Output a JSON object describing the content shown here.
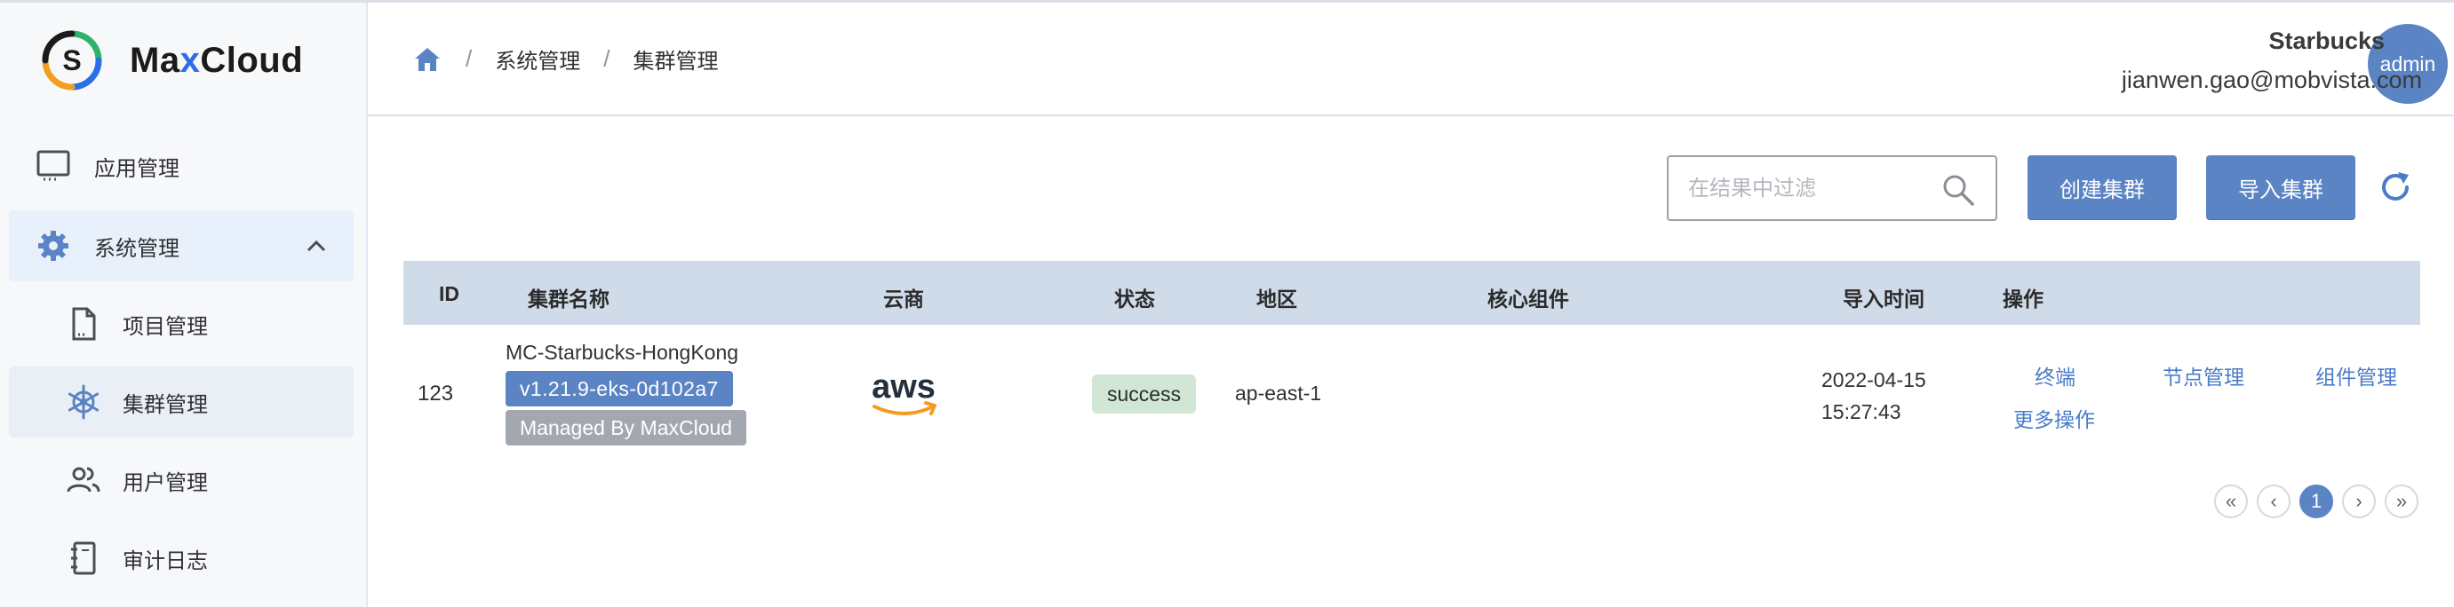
{
  "app": {
    "brand_prefix": "Ma",
    "brand_x": "x",
    "brand_suffix": "Cloud",
    "logo_letter": "S"
  },
  "sidebar": {
    "items": [
      {
        "label": "应用管理",
        "icon": "monitor-icon"
      },
      {
        "label": "系统管理",
        "icon": "gear-icon",
        "expanded": true
      },
      {
        "label": "项目管理",
        "icon": "document-icon"
      },
      {
        "label": "集群管理",
        "icon": "helm-icon",
        "active": true
      },
      {
        "label": "用户管理",
        "icon": "users-icon"
      },
      {
        "label": "审计日志",
        "icon": "notebook-icon"
      }
    ]
  },
  "breadcrumb": {
    "items": [
      "系统管理",
      "集群管理"
    ],
    "separator": "/"
  },
  "user": {
    "avatar_text": "admin",
    "name": "Starbucks",
    "email": "jianwen.gao@mobvista.com"
  },
  "toolbar": {
    "search_placeholder": "在结果中过滤",
    "create_label": "创建集群",
    "import_label": "导入集群"
  },
  "table": {
    "headers": {
      "id": "ID",
      "name": "集群名称",
      "cloud": "云商",
      "status": "状态",
      "region": "地区",
      "components": "核心组件",
      "import_time": "导入时间",
      "actions": "操作"
    },
    "rows": [
      {
        "id": "123",
        "name": "MC-Starbucks-HongKong",
        "version": "v1.21.9-eks-0d102a7",
        "managed": "Managed By MaxCloud",
        "cloud_logo": "aws",
        "status": "success",
        "region": "ap-east-1",
        "components": "",
        "import_date": "2022-04-15",
        "import_clock": "15:27:43",
        "actions": {
          "terminal": "终端",
          "nodes": "节点管理",
          "components": "组件管理",
          "more": "更多操作"
        }
      }
    ]
  },
  "pagination": {
    "first": "«",
    "prev": "‹",
    "current": "1",
    "next": "›",
    "last": "»"
  },
  "colors": {
    "primary": "#5b84c4",
    "link": "#4a7cc7",
    "header_bg": "#cfdbe8",
    "success_bg": "#d2e6d6"
  }
}
